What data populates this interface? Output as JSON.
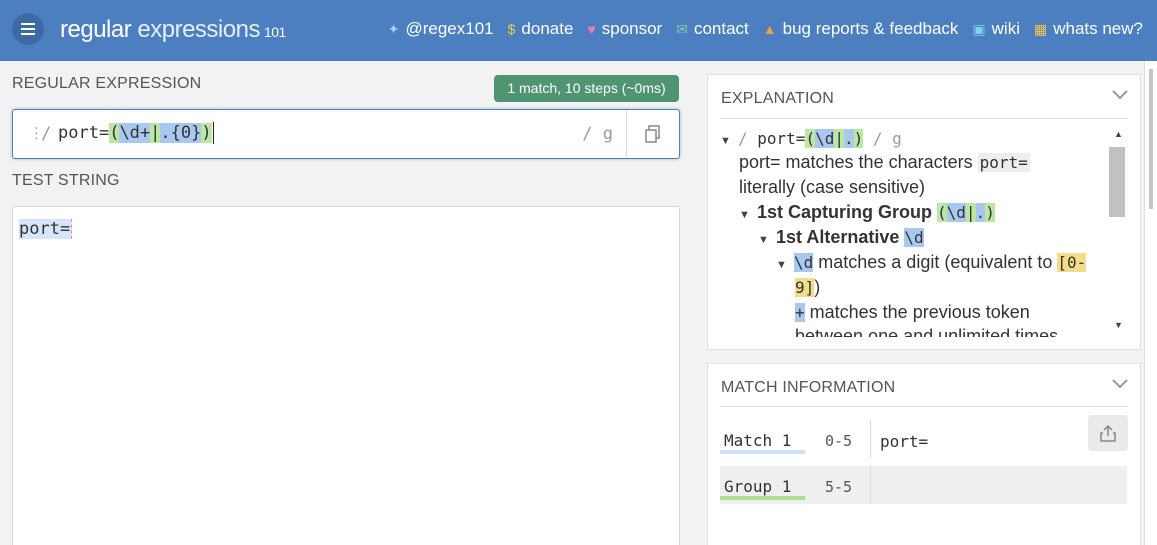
{
  "header": {
    "brand_main": "regular",
    "brand_light": " expressions",
    "brand_num": "101",
    "nav": [
      {
        "icon": "twitter-icon",
        "label": "@regex101",
        "color": "#a9cdf5"
      },
      {
        "icon": "dollar-icon",
        "label": "donate",
        "color": "#f2c94c"
      },
      {
        "icon": "heart-icon",
        "label": "sponsor",
        "color": "#f07ab0"
      },
      {
        "icon": "mail-icon",
        "label": "contact",
        "color": "#7bd1a0"
      },
      {
        "icon": "warning-icon",
        "label": "bug reports & feedback",
        "color": "#f0a24a"
      },
      {
        "icon": "wiki-icon",
        "label": "wiki",
        "color": "#7ad6e8"
      },
      {
        "icon": "news-icon",
        "label": "whats new?",
        "color": "#f2c94c"
      }
    ]
  },
  "regex": {
    "section_label": "REGULAR EXPRESSION",
    "match_summary": "1 match, 10 steps (~0ms)",
    "open_delim": "/",
    "pattern_prefix": "port=",
    "g_open": "(",
    "digit_plus": "\\d+",
    "alt_bar": "|",
    "any_quant": ".{0}",
    "g_close": ")",
    "flags": "/ g"
  },
  "test": {
    "section_label": "TEST STRING",
    "value": "port="
  },
  "explanation": {
    "title": "EXPLANATION",
    "line1_delim": "/ ",
    "line1_prefix": "port=",
    "line1_open": "(",
    "line1_d": "\\d",
    "line1_bar": "|",
    "line1_dot": ".",
    "line1_close": ")",
    "line1_flags": " / g",
    "line2_code": "port=",
    "line2_text": " matches the characters ",
    "line2_code2": "port=",
    "line3": "literally (case sensitive)",
    "group1_label": "1st Capturing Group",
    "alt1_label": "1st Alternative",
    "alt1_code": "\\d",
    "digit_code": "\\d",
    "digit_text": " matches a digit (equivalent to ",
    "digit_range_a": "[0-",
    "digit_range_b": "9]",
    "digit_close": ")",
    "plus_code": "+",
    "plus_text": " matches the previous token",
    "cut_line": "between one and unlimited times"
  },
  "match_info": {
    "title": "MATCH INFORMATION",
    "rows": [
      {
        "name": "Match 1",
        "range": "0-5",
        "value": "port="
      },
      {
        "name": "Group 1",
        "range": "5-5",
        "value": ""
      }
    ]
  }
}
